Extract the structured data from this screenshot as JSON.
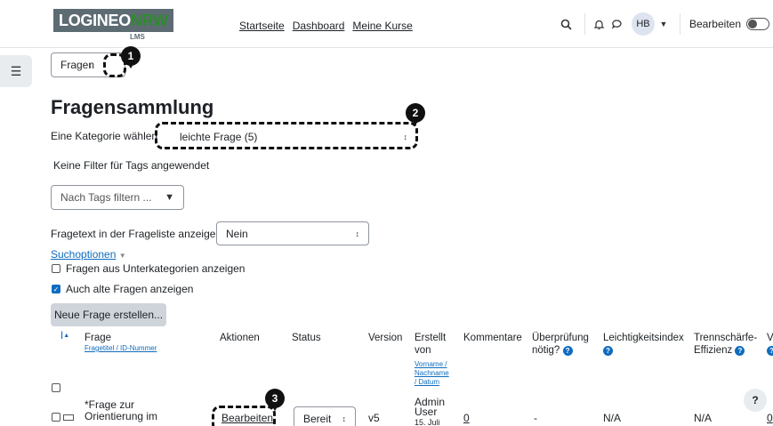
{
  "navbar": {
    "logo_main": "LOGINEO",
    "logo_accent": "NRW",
    "logo_sub": "LMS",
    "links": [
      "Startseite",
      "Dashboard",
      "Meine Kurse"
    ],
    "search_icon": "search-icon",
    "bell_icon": "bell-icon",
    "chat_icon": "chat-icon",
    "avatar_initials": "HB",
    "edit_label": "Bearbeiten"
  },
  "top_select": {
    "value": "Fragen"
  },
  "page_title": "Fragensammlung",
  "category": {
    "label": "Eine Kategorie wählen:",
    "value": "leichte Frage (5)"
  },
  "tag_filter": {
    "none_text": "Keine Filter für Tags angewendet",
    "placeholder": "Nach Tags filtern ..."
  },
  "show_text": {
    "label": "Fragetext in der Frageliste anzeigen?",
    "value": "Nein"
  },
  "search_options": {
    "link": "Suchoptionen",
    "subcategories": "Fragen aus Unterkategorien anzeigen",
    "old_questions": "Auch alte Fragen anzeigen"
  },
  "new_question_button": "Neue Frage erstellen...",
  "table": {
    "sort_marker": "I",
    "headers": {
      "frage": "Frage",
      "frage_sub_a": "Fragetitel",
      "frage_sub_b": "ID-Nummer",
      "aktionen": "Aktionen",
      "status": "Status",
      "version": "Version",
      "erstellt_1": "Erstellt",
      "erstellt_2": "von",
      "erstellt_sub_a": "Vorname",
      "erstellt_sub_b": "Nachname",
      "erstellt_sub_c": "Datum",
      "kommentare": "Kommentare",
      "ueberpruefung_1": "Überprüfung",
      "ueberpruefung_2": "nötig?",
      "leichtigkeit": "Leichtigkeitsindex",
      "trenn_1": "Trennschärfe-",
      "trenn_2": "Effizienz",
      "cut": "V"
    },
    "row": {
      "name_1": "*Frage zur",
      "name_2": "Orientierung im",
      "action": "Bearbeiten",
      "status": "Bereit",
      "version": "v5",
      "creator_1": "Admin",
      "creator_2": "User",
      "creator_3": "15. Juli",
      "comments": "0",
      "review": "-",
      "easiness": "N/A",
      "discrimination": "N/A",
      "cut": "0"
    }
  },
  "markers": [
    "1",
    "2",
    "3"
  ],
  "help_fab": "?"
}
